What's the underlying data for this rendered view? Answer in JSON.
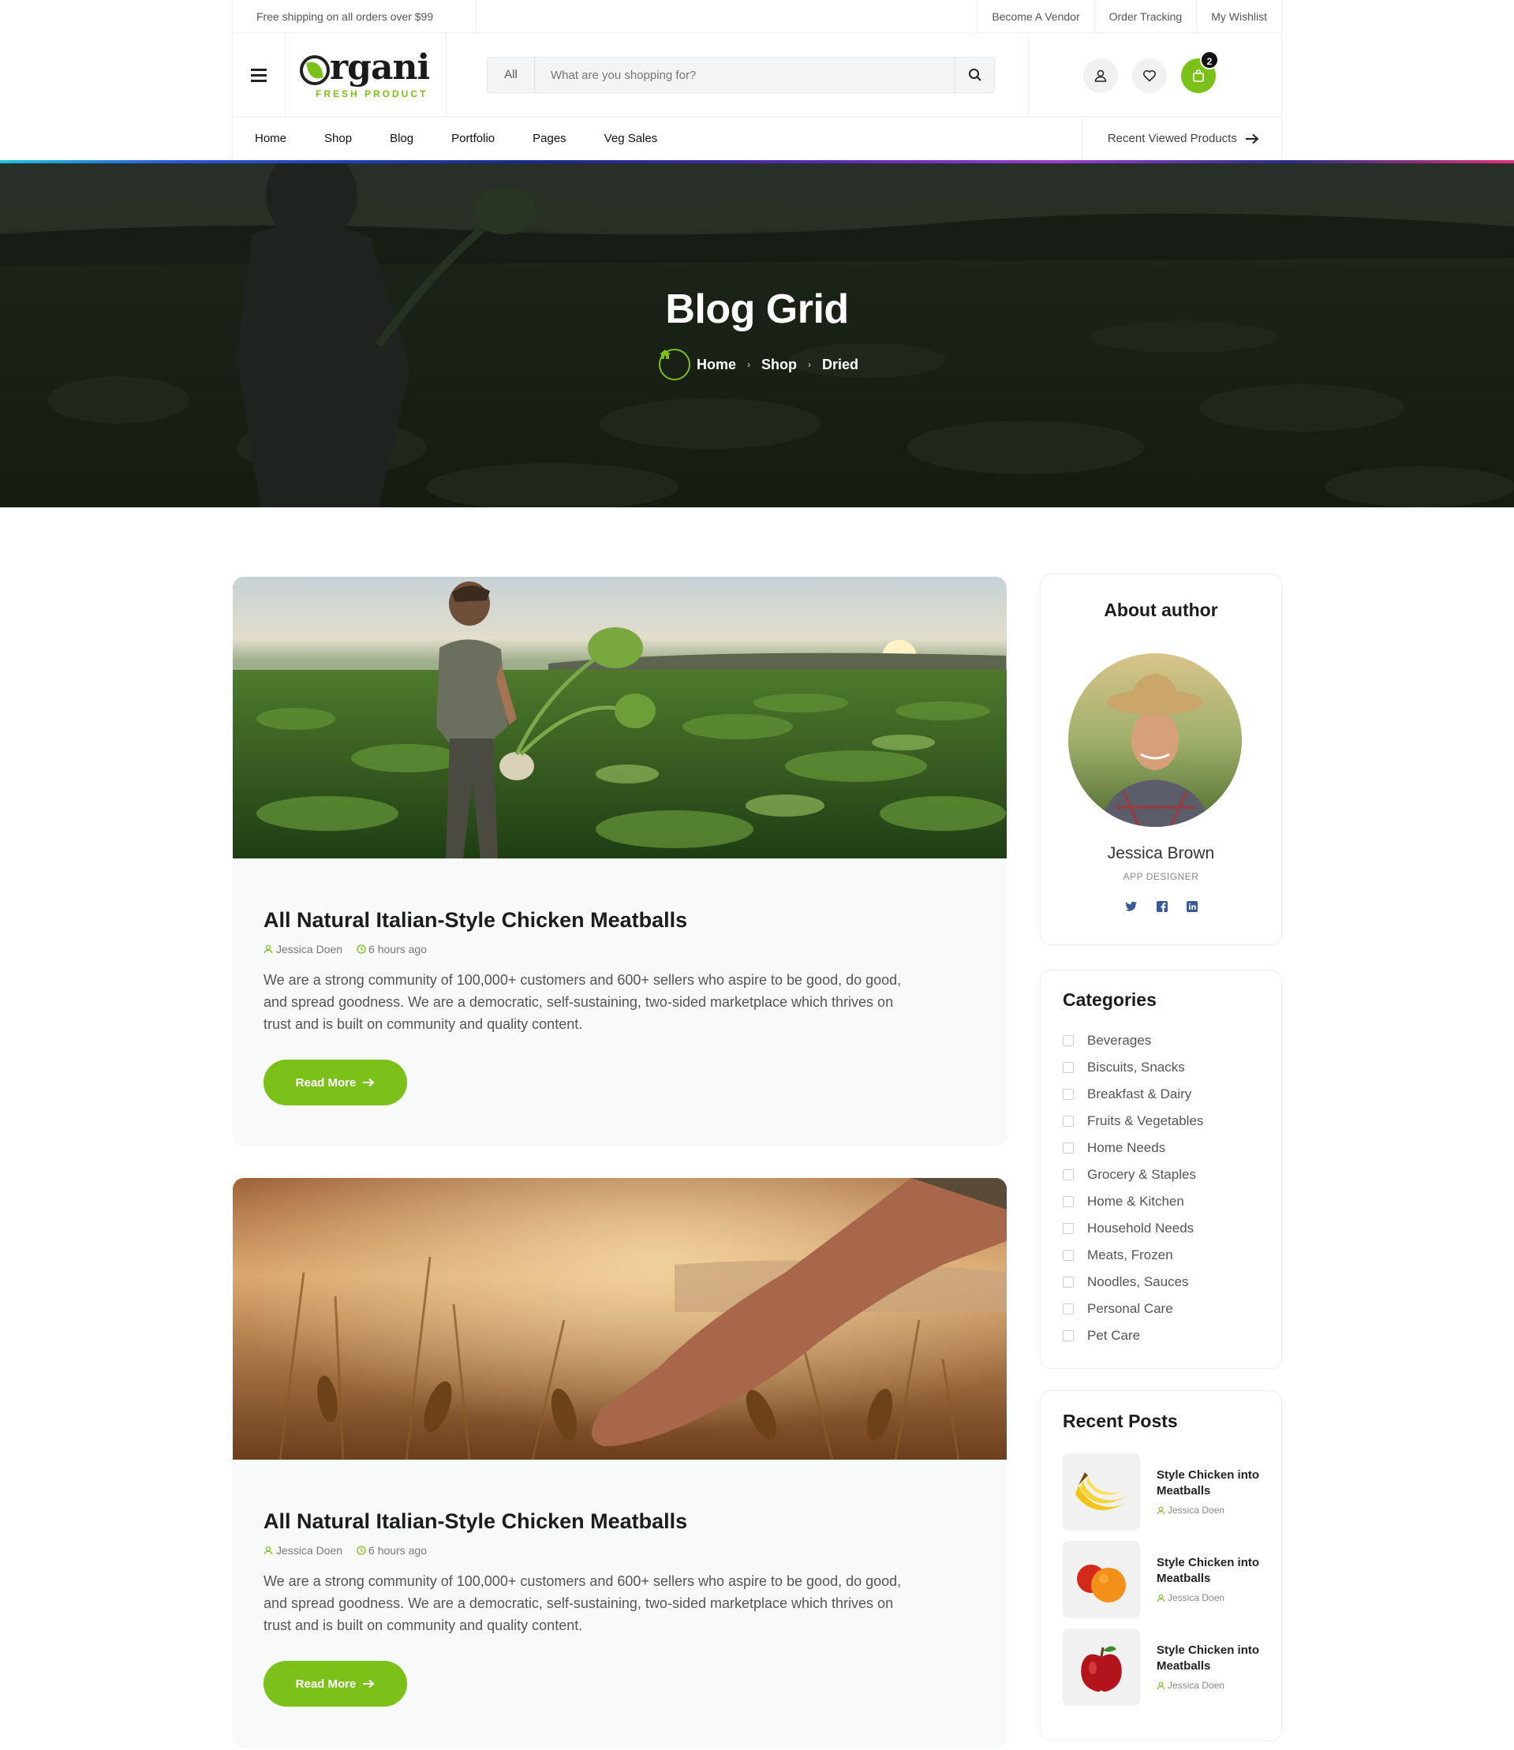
{
  "topbar": {
    "shipping": "Free shipping on all orders over $99",
    "links": [
      "Become A Vendor",
      "Order Tracking",
      "My Wishlist"
    ]
  },
  "logo": {
    "word": "rgani",
    "sub": "FRESH PRODUCT"
  },
  "search": {
    "category": "All",
    "placeholder": "What are you shopping for?"
  },
  "cart": {
    "count": "2"
  },
  "nav": {
    "items": [
      "Home",
      "Shop",
      "Blog",
      "Portfolio",
      "Pages",
      "Veg Sales"
    ],
    "recent": "Recent Viewed Products"
  },
  "hero": {
    "title": "Blog Grid",
    "breadcrumb": [
      "Home",
      "Shop",
      "Dried"
    ]
  },
  "posts": [
    {
      "title": "All Natural Italian-Style Chicken Meatballs",
      "author": "Jessica Doen",
      "time": "6 hours ago",
      "excerpt": "We are a strong community of 100,000+ customers and 600+ sellers who aspire to be good, do good, and spread goodness. We are a democratic, self-sustaining, two-sided marketplace which thrives on trust and is built on community and quality content.",
      "button": "Read More"
    },
    {
      "title": "All Natural Italian-Style Chicken Meatballs",
      "author": "Jessica Doen",
      "time": "6 hours ago",
      "excerpt": "We are a strong community of 100,000+ customers and 600+ sellers who aspire to be good, do good, and spread goodness. We are a democratic, self-sustaining, two-sided marketplace which thrives on trust and is built on community and quality content.",
      "button": "Read More"
    }
  ],
  "author": {
    "heading": "About author",
    "name": "Jessica Brown",
    "role": "APP DESIGNER",
    "social": [
      "twitter-icon",
      "facebook-icon",
      "linkedin-icon"
    ]
  },
  "categories": {
    "heading": "Categories",
    "items": [
      "Beverages",
      "Biscuits, Snacks",
      "Breakfast & Dairy",
      "Fruits & Vegetables",
      "Home Needs",
      "Grocery & Staples",
      "Home & Kitchen",
      "Household Needs",
      "Meats, Frozen",
      "Noodles, Sauces",
      "Personal Care",
      "Pet Care"
    ]
  },
  "recent_posts": {
    "heading": "Recent Posts",
    "items": [
      {
        "title": "Style Chicken into Meatballs",
        "author": "Jessica Doen",
        "thumb": "banana"
      },
      {
        "title": "Style Chicken into Meatballs",
        "author": "Jessica Doen",
        "thumb": "orange"
      },
      {
        "title": "Style Chicken into Meatballs",
        "author": "Jessica Doen",
        "thumb": "apple"
      }
    ]
  },
  "colors": {
    "accent": "#7cc01a",
    "dark": "#1c1c1c"
  }
}
